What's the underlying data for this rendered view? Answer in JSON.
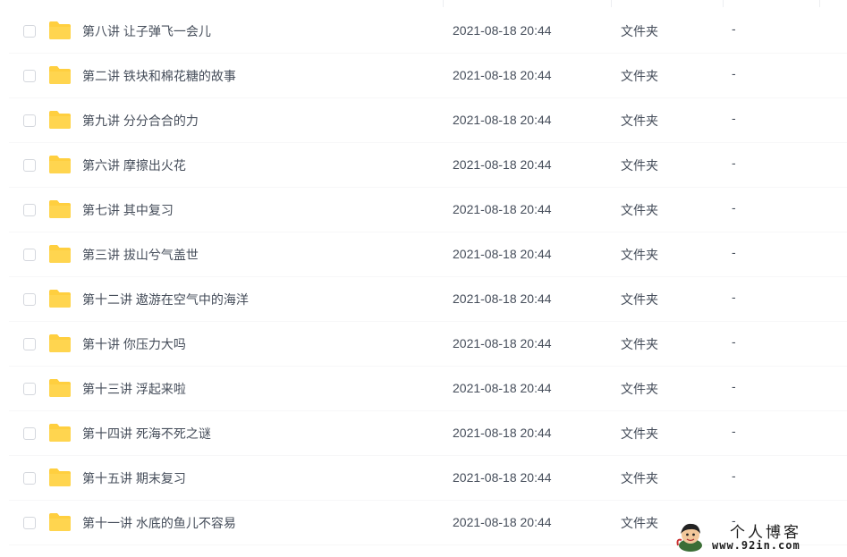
{
  "file_list": {
    "folder_icon": "folder-icon",
    "rows": [
      {
        "name": "第八讲 让子弹飞一会儿",
        "modified": "2021-08-18 20:44",
        "type": "文件夹",
        "size": "-"
      },
      {
        "name": "第二讲 铁块和棉花糖的故事",
        "modified": "2021-08-18 20:44",
        "type": "文件夹",
        "size": "-"
      },
      {
        "name": "第九讲 分分合合的力",
        "modified": "2021-08-18 20:44",
        "type": "文件夹",
        "size": "-"
      },
      {
        "name": "第六讲 摩擦出火花",
        "modified": "2021-08-18 20:44",
        "type": "文件夹",
        "size": "-"
      },
      {
        "name": "第七讲 其中复习",
        "modified": "2021-08-18 20:44",
        "type": "文件夹",
        "size": "-"
      },
      {
        "name": "第三讲 拔山兮气盖世",
        "modified": "2021-08-18 20:44",
        "type": "文件夹",
        "size": "-"
      },
      {
        "name": "第十二讲 遨游在空气中的海洋",
        "modified": "2021-08-18 20:44",
        "type": "文件夹",
        "size": "-"
      },
      {
        "name": "第十讲 你压力大吗",
        "modified": "2021-08-18 20:44",
        "type": "文件夹",
        "size": "-"
      },
      {
        "name": "第十三讲 浮起来啦",
        "modified": "2021-08-18 20:44",
        "type": "文件夹",
        "size": "-"
      },
      {
        "name": "第十四讲 死海不死之谜",
        "modified": "2021-08-18 20:44",
        "type": "文件夹",
        "size": "-"
      },
      {
        "name": "第十五讲 期末复习",
        "modified": "2021-08-18 20:44",
        "type": "文件夹",
        "size": "-"
      },
      {
        "name": "第十一讲 水底的鱼儿不容易",
        "modified": "2021-08-18 20:44",
        "type": "文件夹",
        "size": "-"
      }
    ]
  },
  "watermark": {
    "title": "个人博客",
    "url": "www.92in.com"
  },
  "colors": {
    "folder": "#ffcf3f",
    "text": "#454d5a",
    "checkbox_border": "#d4d7dd",
    "divider": "#eceef1"
  }
}
